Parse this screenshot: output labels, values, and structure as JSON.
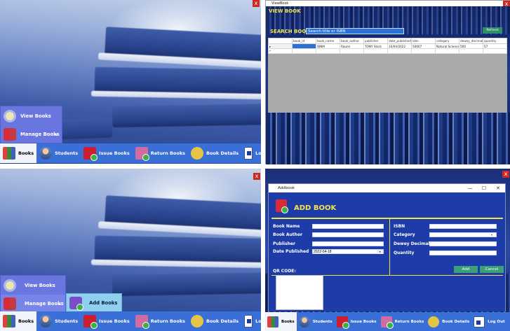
{
  "close_glyph": "x",
  "taskbar": [
    {
      "key": "books",
      "label": "Books"
    },
    {
      "key": "students",
      "label": "Students"
    },
    {
      "key": "issue",
      "label": "Issue Books"
    },
    {
      "key": "return",
      "label": "Return Books"
    },
    {
      "key": "details",
      "label": "Book Details"
    },
    {
      "key": "logout",
      "label": "Log Out"
    }
  ],
  "menu": {
    "view_books": "View Books",
    "manage_books": "Manage Books",
    "submenu_arrow": "▸",
    "add_books": "Add Books"
  },
  "view_window": {
    "title": "ViewBook",
    "heading": "VIEW BOOK",
    "search_label": "SEARCH BOOK",
    "search_placeholder": "Search title or ISBN",
    "refresh_button": "Refresh",
    "columns": [
      "book_id",
      "book_name",
      "book_author",
      "publisher",
      "date_published",
      "isbn",
      "category",
      "dewey_decimal",
      "quantity"
    ],
    "rows": [
      [
        "",
        "IBNM",
        "Raumi",
        "TONY Stark",
        "10/04/2022",
        "50007",
        "Natural Sciences",
        "500",
        "57"
      ]
    ]
  },
  "add_window": {
    "title": "Addbook",
    "minimize": "—",
    "maximize": "☐",
    "close": "✕",
    "heading": "ADD BOOK",
    "fields_left": [
      {
        "label": "Book Name",
        "value": ""
      },
      {
        "label": "Book Author",
        "value": ""
      },
      {
        "label": "Publisher",
        "value": ""
      },
      {
        "label": "Date Published",
        "value": "2022-04-18"
      }
    ],
    "fields_right": [
      {
        "label": "ISBN",
        "value": ""
      },
      {
        "label": "Category",
        "value": ""
      },
      {
        "label": "Dewey Decimal",
        "value": ""
      },
      {
        "label": "Quantity",
        "value": ""
      }
    ],
    "qr_label": "QR CODE:",
    "add_button": "Add",
    "cancel_button": "Cancel"
  },
  "colors": {
    "taskbar": "#3a6fd8",
    "menu": "#6a76e0",
    "accent_yellow": "#f4e44c",
    "button_green": "#3b9f77",
    "close_red": "#cc2a20"
  }
}
